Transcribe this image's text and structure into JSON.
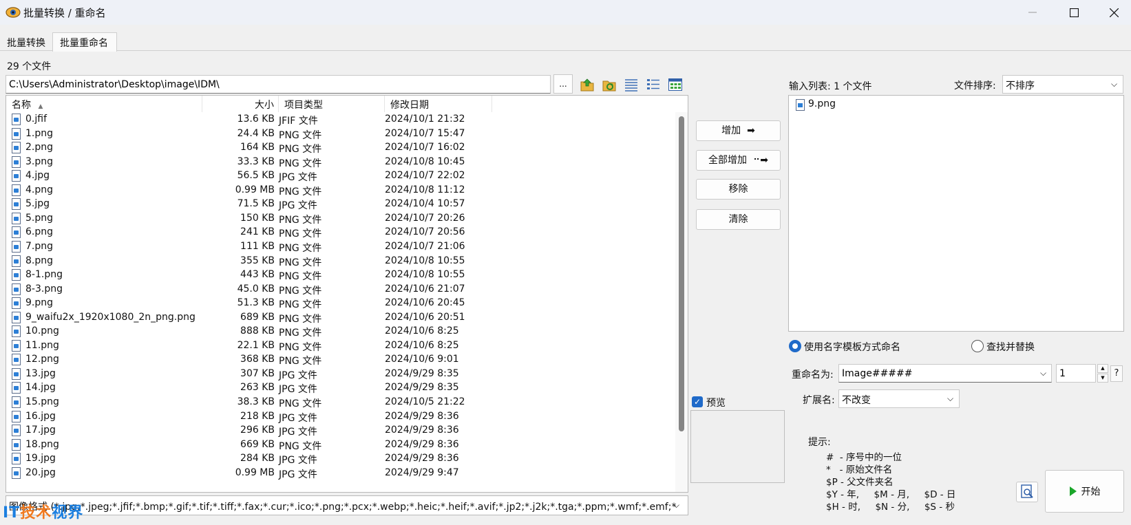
{
  "window": {
    "title": "批量转换 / 重命名"
  },
  "tabs": [
    {
      "label": "批量转换",
      "active": false
    },
    {
      "label": "批量重命名",
      "active": true
    }
  ],
  "file_count": "29 个文件",
  "path": "C:\\Users\\Administrator\\Desktop\\image\\IDM\\",
  "browse_label": "...",
  "columns": {
    "name": "名称",
    "size": "大小",
    "type": "项目类型",
    "date": "修改日期"
  },
  "files": [
    {
      "name": "0.jfif",
      "size": "13.6 KB",
      "type": "JFIF 文件",
      "date": "2024/10/1 21:32"
    },
    {
      "name": "1.png",
      "size": "24.4 KB",
      "type": "PNG 文件",
      "date": "2024/10/7 15:47"
    },
    {
      "name": "2.png",
      "size": "164 KB",
      "type": "PNG 文件",
      "date": "2024/10/7 16:02"
    },
    {
      "name": "3.png",
      "size": "33.3 KB",
      "type": "PNG 文件",
      "date": "2024/10/8 10:45"
    },
    {
      "name": "4.jpg",
      "size": "56.5 KB",
      "type": "JPG 文件",
      "date": "2024/10/7 22:02"
    },
    {
      "name": "4.png",
      "size": "0.99 MB",
      "type": "PNG 文件",
      "date": "2024/10/8 11:12"
    },
    {
      "name": "5.jpg",
      "size": "71.5 KB",
      "type": "JPG 文件",
      "date": "2024/10/4 10:57"
    },
    {
      "name": "5.png",
      "size": "150 KB",
      "type": "PNG 文件",
      "date": "2024/10/7 20:26"
    },
    {
      "name": "6.png",
      "size": "241 KB",
      "type": "PNG 文件",
      "date": "2024/10/7 20:56"
    },
    {
      "name": "7.png",
      "size": "111 KB",
      "type": "PNG 文件",
      "date": "2024/10/7 21:06"
    },
    {
      "name": "8.png",
      "size": "355 KB",
      "type": "PNG 文件",
      "date": "2024/10/8 10:55"
    },
    {
      "name": "8-1.png",
      "size": "443 KB",
      "type": "PNG 文件",
      "date": "2024/10/8 10:55"
    },
    {
      "name": "8-3.png",
      "size": "45.0 KB",
      "type": "PNG 文件",
      "date": "2024/10/6 21:07"
    },
    {
      "name": "9.png",
      "size": "51.3 KB",
      "type": "PNG 文件",
      "date": "2024/10/6 20:45"
    },
    {
      "name": "9_waifu2x_1920x1080_2n_png.png",
      "size": "689 KB",
      "type": "PNG 文件",
      "date": "2024/10/6 20:51"
    },
    {
      "name": "10.png",
      "size": "888 KB",
      "type": "PNG 文件",
      "date": "2024/10/6 8:25"
    },
    {
      "name": "11.png",
      "size": "22.1 KB",
      "type": "PNG 文件",
      "date": "2024/10/6 8:25"
    },
    {
      "name": "12.png",
      "size": "368 KB",
      "type": "PNG 文件",
      "date": "2024/10/6 9:01"
    },
    {
      "name": "13.jpg",
      "size": "307 KB",
      "type": "JPG 文件",
      "date": "2024/9/29 8:35"
    },
    {
      "name": "14.jpg",
      "size": "263 KB",
      "type": "JPG 文件",
      "date": "2024/9/29 8:35"
    },
    {
      "name": "15.png",
      "size": "38.3 KB",
      "type": "PNG 文件",
      "date": "2024/10/5 21:22"
    },
    {
      "name": "16.jpg",
      "size": "218 KB",
      "type": "JPG 文件",
      "date": "2024/9/29 8:36"
    },
    {
      "name": "17.jpg",
      "size": "296 KB",
      "type": "JPG 文件",
      "date": "2024/9/29 8:36"
    },
    {
      "name": "18.png",
      "size": "669 KB",
      "type": "PNG 文件",
      "date": "2024/9/29 8:36"
    },
    {
      "name": "19.jpg",
      "size": "284 KB",
      "type": "JPG 文件",
      "date": "2024/9/29 8:36"
    },
    {
      "name": "20.jpg",
      "size": "0.99 MB",
      "type": "JPG 文件",
      "date": "2024/9/29 9:47"
    }
  ],
  "filter": "图像格式 (*.jpg;*.jpeg;*.jfif;*.bmp;*.gif;*.tif;*.tiff;*.fax;*.cur;*.ico;*.png;*.pcx;*.webp;*.heic;*.heif;*.avif;*.jp2;*.j2k;*.tga;*.ppm;*.wmf;*.emf;*",
  "buttons": {
    "add": "增加",
    "add_all": "全部增加",
    "remove": "移除",
    "clear": "清除",
    "start": "开始"
  },
  "preview": {
    "label": "预览",
    "checked": true
  },
  "input_list": {
    "label": "输入列表: 1 个文件",
    "items": [
      {
        "name": "9.png"
      }
    ]
  },
  "sort": {
    "label": "文件排序:",
    "value": "不排序"
  },
  "mode": {
    "template_label": "使用名字模板方式命名",
    "replace_label": "查找并替换",
    "selected": "template"
  },
  "rename": {
    "label": "重命名为:",
    "value": "Image#####",
    "start": "1",
    "help": "?"
  },
  "extension": {
    "label": "扩展名:",
    "value": "不改变"
  },
  "hints": {
    "title": "提示:",
    "lines": [
      "#  - 序号中的一位",
      "*   - 原始文件名",
      "$P - 父文件夹名",
      "$Y - 年,     $M - 月,     $D - 日",
      "$H - 时,     $N - 分,     $S - 秒"
    ]
  },
  "watermark": {
    "a": "IT",
    "b": "技术",
    "c": "视界"
  },
  "colors": {
    "accent": "#1f6ac9",
    "start_icon": "#1aa62a",
    "titlebar": "#eef1f7"
  }
}
